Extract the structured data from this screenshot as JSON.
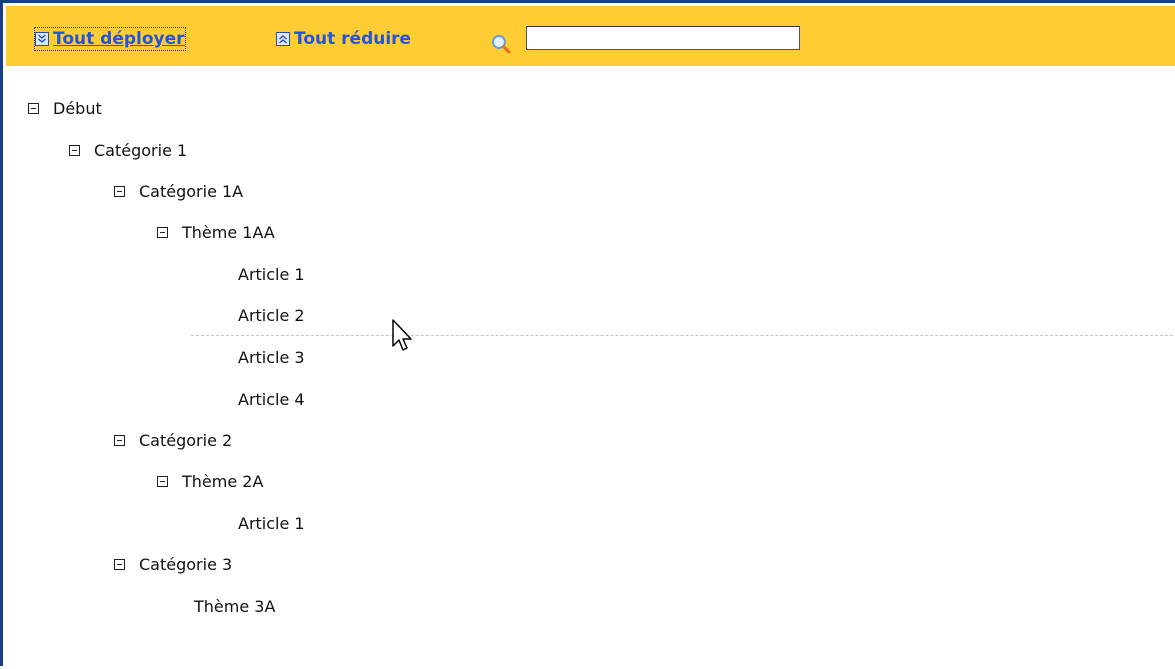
{
  "toolbar": {
    "expand_all_label": "Tout déployer",
    "collapse_all_label": "Tout réduire",
    "search": {
      "value": "",
      "placeholder": ""
    }
  },
  "tree": {
    "root": "Début",
    "cat1": "Catégorie 1",
    "cat1a": "Catégorie 1A",
    "theme1aa": "Thème 1AA",
    "articles_1aa": [
      "Article 1",
      "Article 2",
      "Article 3",
      "Article 4"
    ],
    "cat2": "Catégorie 2",
    "theme2a": "Thème 2A",
    "articles_2a": [
      "Article 1"
    ],
    "cat3": "Catégorie 3",
    "theme3a": "Thème 3A"
  },
  "colors": {
    "toolbar_bg": "#ffcc33",
    "link": "#2255dd",
    "frame_border": "#1a3c8c"
  }
}
